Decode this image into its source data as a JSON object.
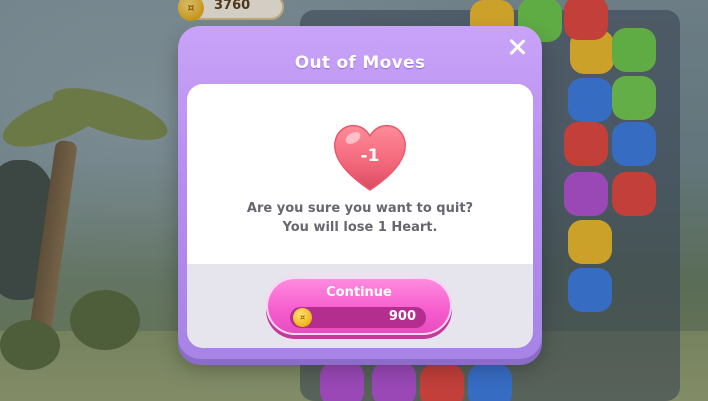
{
  "hud": {
    "coins": "3760"
  },
  "dialog": {
    "title": "Out of Moves",
    "heart_cost": "-1",
    "message_line1": "Are you sure you want to quit?",
    "message_line2": "You will lose 1 Heart.",
    "continue_label": "Continue",
    "continue_price": "900"
  },
  "icons": {
    "close": "close-icon",
    "heart": "heart-icon",
    "coin": "coin-icon"
  },
  "colors": {
    "dialog_purple": "#b78df0",
    "continue_pink": "#f65fcf",
    "heart_red": "#f2667a",
    "coin_gold": "#f0b319"
  }
}
